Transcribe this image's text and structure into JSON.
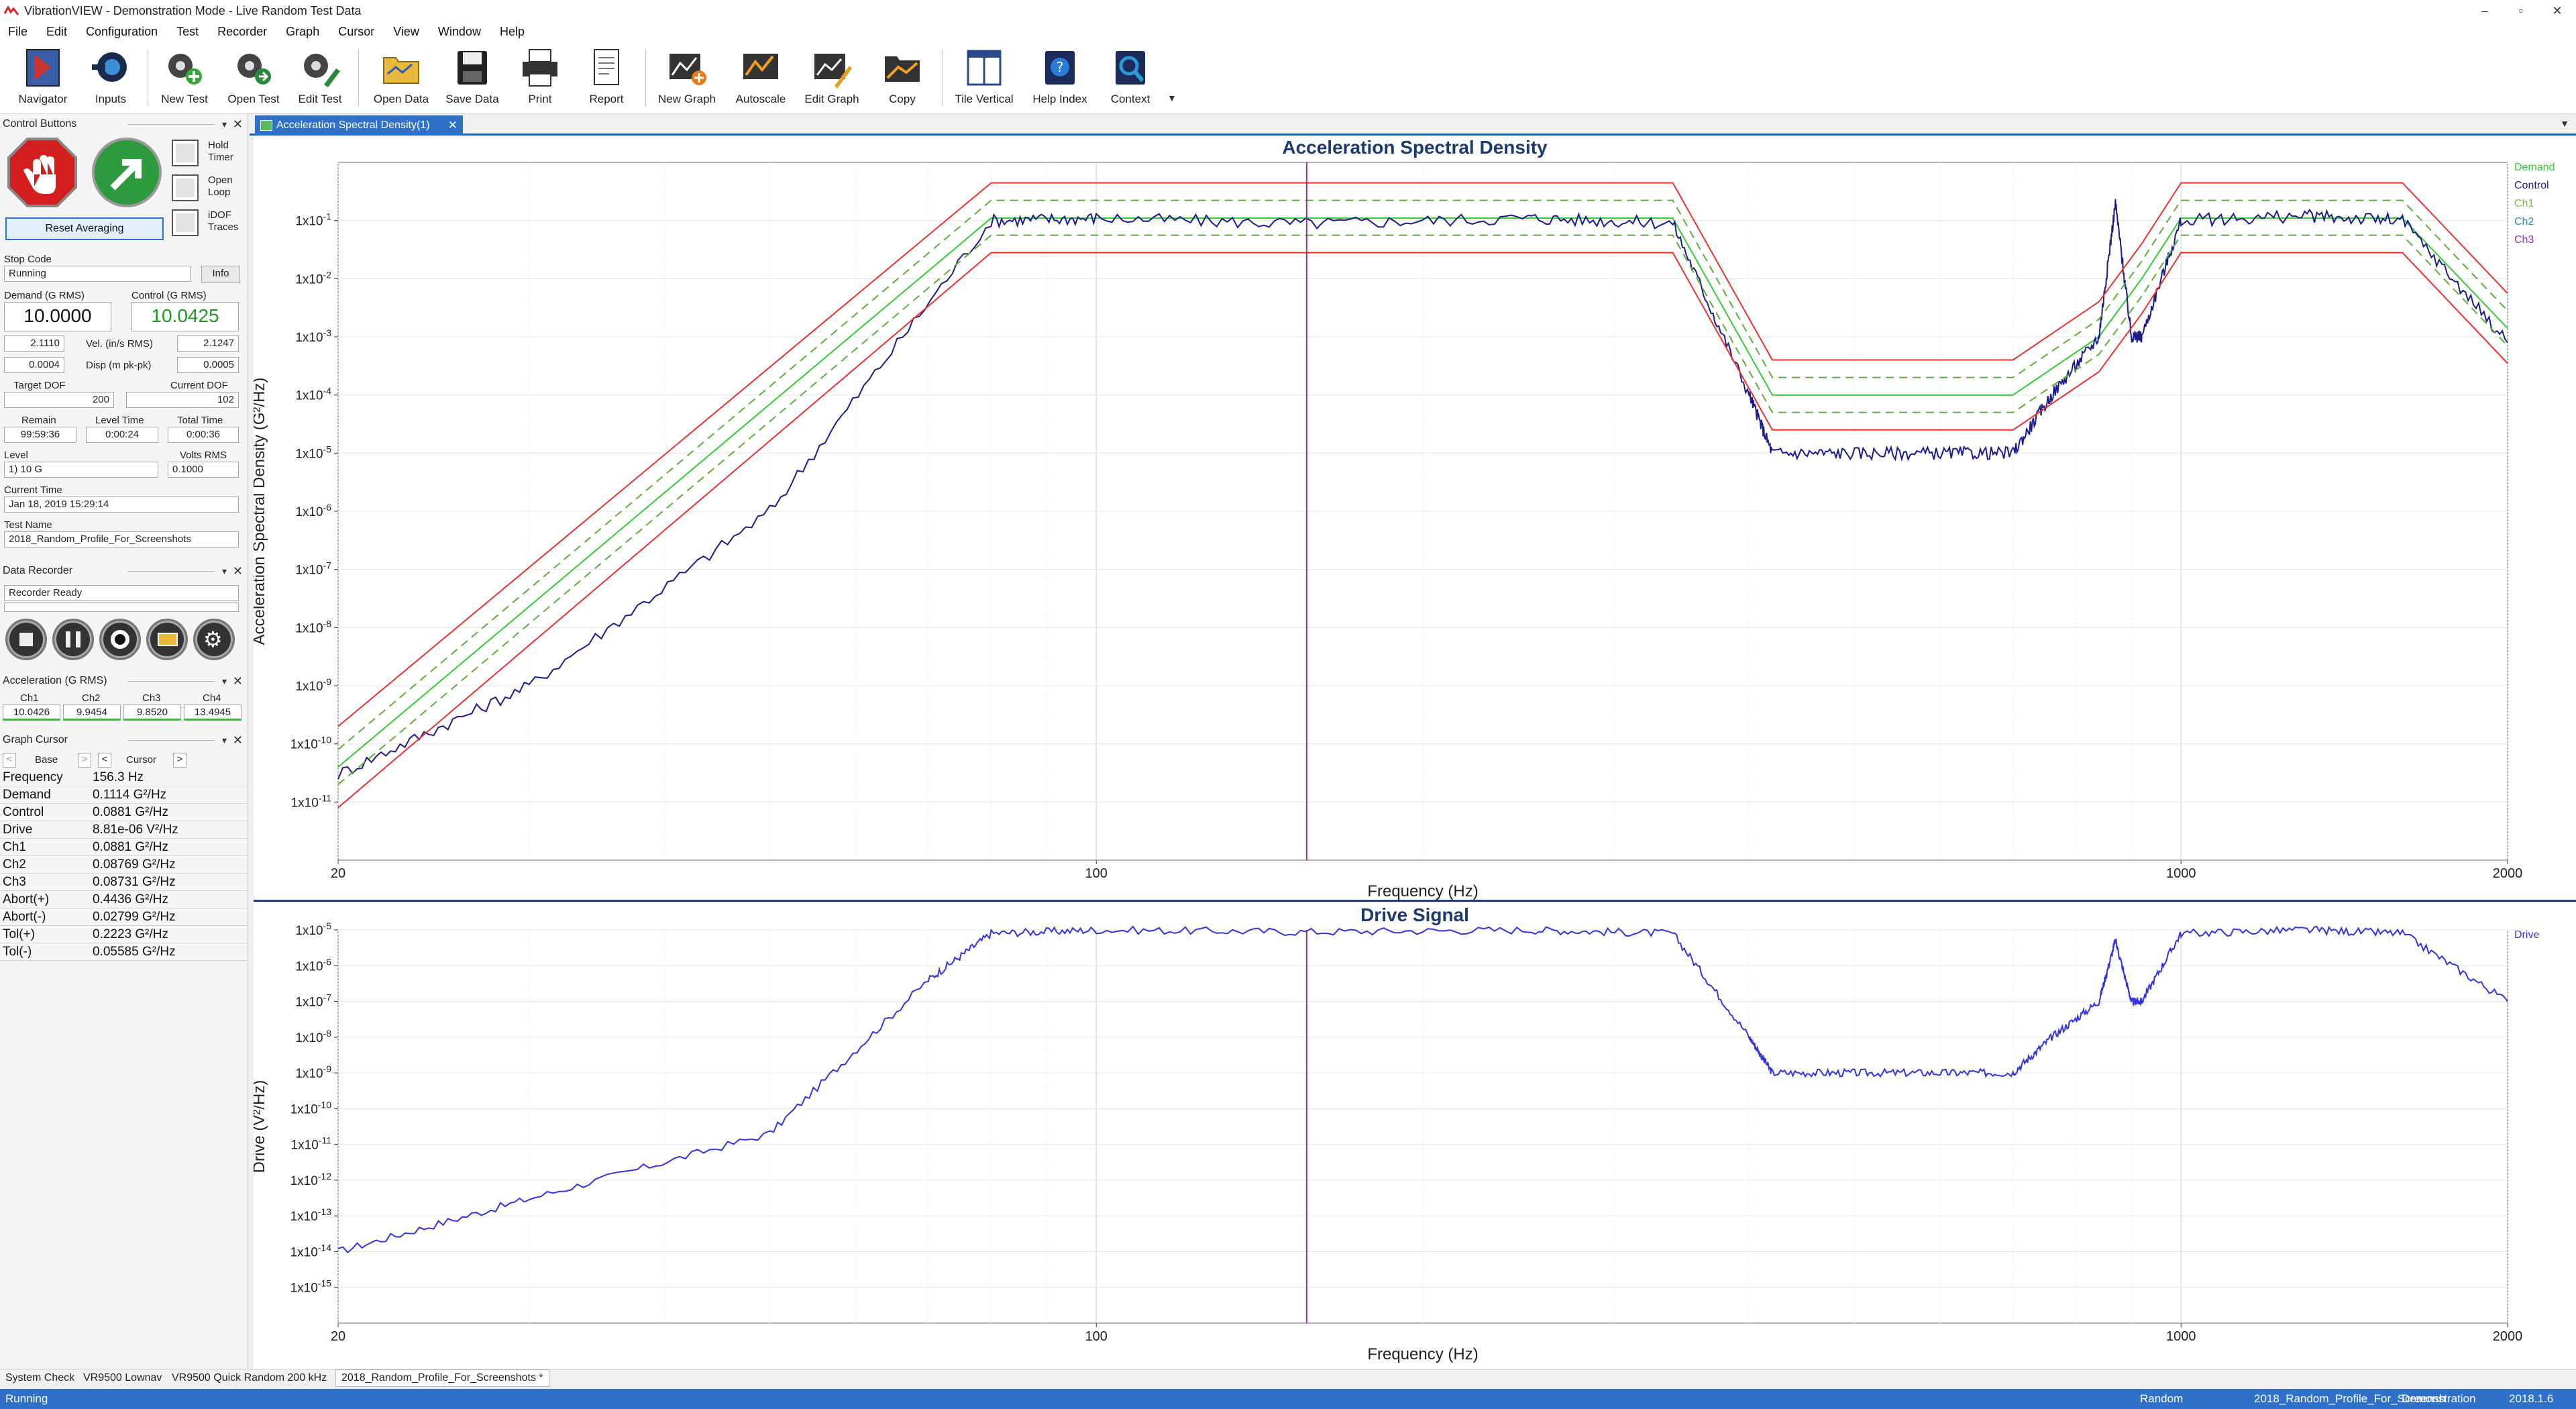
{
  "window": {
    "title": "VibrationVIEW - Demonstration Mode - Live Random Test Data",
    "controls": [
      "–",
      "▫",
      "✕"
    ]
  },
  "menu": [
    "File",
    "Edit",
    "Configuration",
    "Test",
    "Recorder",
    "Graph",
    "Cursor",
    "View",
    "Window",
    "Help"
  ],
  "toolbar": [
    {
      "label": "Navigator",
      "icon": "navigator-icon"
    },
    {
      "label": "Inputs",
      "icon": "inputs-icon"
    },
    {
      "label": "New Test",
      "icon": "new-test-icon"
    },
    {
      "label": "Open Test",
      "icon": "open-test-icon"
    },
    {
      "label": "Edit Test",
      "icon": "edit-test-icon"
    },
    {
      "label": "Open Data",
      "icon": "open-data-icon"
    },
    {
      "label": "Save Data",
      "icon": "save-data-icon"
    },
    {
      "label": "Print",
      "icon": "print-icon"
    },
    {
      "label": "Report",
      "icon": "report-icon"
    },
    {
      "label": "New Graph",
      "icon": "new-graph-icon"
    },
    {
      "label": "Autoscale",
      "icon": "autoscale-icon"
    },
    {
      "label": "Edit Graph",
      "icon": "edit-graph-icon"
    },
    {
      "label": "Copy",
      "icon": "copy-icon"
    },
    {
      "label": "Tile Vertical",
      "icon": "tile-vertical-icon"
    },
    {
      "label": "Help Index",
      "icon": "help-index-icon"
    },
    {
      "label": "Context",
      "icon": "context-icon"
    }
  ],
  "control_buttons": {
    "header": "Control Buttons",
    "hold_timer": "Hold Timer",
    "open_loop": "Open Loop",
    "idof_traces": "iDOF Traces",
    "reset_averaging": "Reset Averaging",
    "stop_code_label": "Stop Code",
    "stop_code_value": "Running",
    "info_button": "Info",
    "demand_label": "Demand (G RMS)",
    "demand_value": "10.0000",
    "control_label": "Control (G RMS)",
    "control_value": "10.0425",
    "vel_label": "Vel. (in/s RMS)",
    "vel_demand": "2.1110",
    "vel_control": "2.1247",
    "disp_label": "Disp (m pk-pk)",
    "disp_demand": "0.0004",
    "disp_control": "0.0005",
    "target_dof_label": "Target DOF",
    "target_dof_value": "200",
    "current_dof_label": "Current DOF",
    "current_dof_value": "102",
    "remain_label": "Remain",
    "remain_value": "99:59:36",
    "level_time_label": "Level Time",
    "level_time_value": "0:00:24",
    "total_time_label": "Total Time",
    "total_time_value": "0:00:36",
    "level_label": "Level",
    "level_value": "1) 10 G",
    "volts_rms_label": "Volts RMS",
    "volts_rms_value": "0.1000",
    "current_time_label": "Current Time",
    "current_time_value": "Jan 18, 2019 15:29:14",
    "test_name_label": "Test Name",
    "test_name_value": "2018_Random_Profile_For_Screenshots"
  },
  "data_recorder": {
    "header": "Data Recorder",
    "status": "Recorder Ready"
  },
  "acceleration": {
    "header": "Acceleration (G RMS)",
    "channels": [
      {
        "name": "Ch1",
        "value": "10.0426"
      },
      {
        "name": "Ch2",
        "value": "9.9454"
      },
      {
        "name": "Ch3",
        "value": "9.8520"
      },
      {
        "name": "Ch4",
        "value": "13.4945"
      }
    ]
  },
  "graph_cursor": {
    "header": "Graph Cursor",
    "base_label": "Base",
    "cursor_label": "Cursor",
    "rows": [
      {
        "name": "Frequency",
        "value": "156.3  Hz"
      },
      {
        "name": "Demand",
        "value": "0.1114  G²/Hz"
      },
      {
        "name": "Control",
        "value": "0.0881  G²/Hz"
      },
      {
        "name": "Drive",
        "value": "8.81e-06  V²/Hz"
      },
      {
        "name": "Ch1",
        "value": "0.0881  G²/Hz"
      },
      {
        "name": "Ch2",
        "value": "0.08769  G²/Hz"
      },
      {
        "name": "Ch3",
        "value": "0.08731  G²/Hz"
      },
      {
        "name": "Abort(+)",
        "value": "0.4436  G²/Hz"
      },
      {
        "name": "Abort(-)",
        "value": "0.02799  G²/Hz"
      },
      {
        "name": "Tol(+)",
        "value": "0.2223  G²/Hz"
      },
      {
        "name": "Tol(-)",
        "value": "0.05585  G²/Hz"
      }
    ]
  },
  "doc_tab": {
    "label": "Acceleration Spectral Density(1)"
  },
  "colors": {
    "accent": "#2f71c9",
    "abort": "#e8312f",
    "tolerance": "#5eac3a",
    "demand": "#36c936",
    "control": "#1b1b8a",
    "ch1": "#7fbf3f",
    "ch2": "#1e90c8",
    "ch3": "#9b2fb5",
    "drive": "#3333dd",
    "cursor": "#9b2f8a"
  },
  "chart_data": [
    {
      "type": "line",
      "title": "Acceleration Spectral Density",
      "xlabel": "Frequency (Hz)",
      "ylabel": "Acceleration Spectral Density (G²/Hz)",
      "x_scale": "log",
      "y_scale": "log",
      "xlim": [
        20,
        2000
      ],
      "ylim": [
        1e-12,
        1
      ],
      "x_ticks": [
        "20",
        "100",
        "1000",
        "2000"
      ],
      "y_ticks": [
        {
          "mant": "1x10",
          "exp": "-1"
        },
        {
          "mant": "1x10",
          "exp": "-2"
        },
        {
          "mant": "1x10",
          "exp": "-3"
        },
        {
          "mant": "1x10",
          "exp": "-4"
        },
        {
          "mant": "1x10",
          "exp": "-5"
        },
        {
          "mant": "1x10",
          "exp": "-6"
        },
        {
          "mant": "1x10",
          "exp": "-7"
        },
        {
          "mant": "1x10",
          "exp": "-8"
        },
        {
          "mant": "1x10",
          "exp": "-9"
        },
        {
          "mant": "1x10",
          "exp": "-10"
        },
        {
          "mant": "1x10",
          "exp": "-11"
        }
      ],
      "legend": [
        "Demand",
        "Control",
        "Ch1",
        "Ch2",
        "Ch3"
      ],
      "cursor_x": 156.3,
      "series": [
        {
          "name": "Demand",
          "x": [
            20,
            80,
            340,
            420,
            700,
            840,
            920,
            1000,
            1600,
            2000
          ],
          "y": [
            4e-11,
            0.11,
            0.11,
            0.0001,
            0.0001,
            0.001,
            0.01,
            0.11,
            0.11,
            0.0014
          ]
        },
        {
          "name": "Control",
          "x": [
            20,
            30,
            50,
            80,
            100,
            156,
            250,
            340,
            400,
            420,
            500,
            600,
            700,
            760,
            840,
            870,
            900,
            920,
            1000,
            1300,
            1600,
            2000
          ],
          "y": [
            3e-11,
            1e-09,
            1e-06,
            0.1,
            0.11,
            0.088,
            0.11,
            0.09,
            0.0001,
            1e-05,
            1e-05,
            1e-05,
            1e-05,
            0.0001,
            0.001,
            0.2,
            0.001,
            0.001,
            0.1,
            0.12,
            0.1,
            0.0008
          ]
        },
        {
          "name": "Abort(+)",
          "x": [
            20,
            80,
            340,
            420,
            700,
            840,
            920,
            1000,
            1600,
            2000
          ],
          "y": [
            2e-10,
            0.4436,
            0.4436,
            0.0004,
            0.0004,
            0.004,
            0.04,
            0.4436,
            0.4436,
            0.0056
          ]
        },
        {
          "name": "Abort(-)",
          "x": [
            20,
            80,
            340,
            420,
            700,
            840,
            920,
            1000,
            1600,
            2000
          ],
          "y": [
            8e-12,
            0.028,
            0.028,
            2.5e-05,
            2.5e-05,
            0.00025,
            0.0025,
            0.028,
            0.028,
            0.00035
          ]
        },
        {
          "name": "Tol(+)",
          "x": [
            20,
            80,
            340,
            420,
            700,
            840,
            920,
            1000,
            1600,
            2000
          ],
          "y": [
            8e-11,
            0.2223,
            0.2223,
            0.0002,
            0.0002,
            0.002,
            0.02,
            0.2223,
            0.2223,
            0.0028
          ]
        },
        {
          "name": "Tol(-)",
          "x": [
            20,
            80,
            340,
            420,
            700,
            840,
            920,
            1000,
            1600,
            2000
          ],
          "y": [
            2e-11,
            0.05585,
            0.05585,
            5e-05,
            5e-05,
            0.0005,
            0.005,
            0.05585,
            0.05585,
            0.0007
          ]
        }
      ]
    },
    {
      "type": "line",
      "title": "Drive Signal",
      "xlabel": "Frequency (Hz)",
      "ylabel": "Drive (V²/Hz)",
      "x_scale": "log",
      "y_scale": "log",
      "xlim": [
        20,
        2000
      ],
      "ylim": [
        1e-16,
        1e-05
      ],
      "x_ticks": [
        "20",
        "100",
        "1000",
        "2000"
      ],
      "y_ticks": [
        {
          "mant": "1x10",
          "exp": "-5"
        },
        {
          "mant": "1x10",
          "exp": "-6"
        },
        {
          "mant": "1x10",
          "exp": "-7"
        },
        {
          "mant": "1x10",
          "exp": "-8"
        },
        {
          "mant": "1x10",
          "exp": "-9"
        },
        {
          "mant": "1x10",
          "exp": "-10"
        },
        {
          "mant": "1x10",
          "exp": "-11"
        },
        {
          "mant": "1x10",
          "exp": "-12"
        },
        {
          "mant": "1x10",
          "exp": "-13"
        },
        {
          "mant": "1x10",
          "exp": "-14"
        },
        {
          "mant": "1x10",
          "exp": "-15"
        }
      ],
      "legend": [
        "Drive"
      ],
      "cursor_x": 156.3,
      "series": [
        {
          "name": "Drive",
          "x": [
            20,
            30,
            50,
            70,
            80,
            100,
            156,
            250,
            340,
            400,
            420,
            500,
            600,
            700,
            760,
            840,
            870,
            900,
            920,
            1000,
            1300,
            1600,
            2000
          ],
          "y": [
            1e-14,
            3e-13,
            2e-11,
            4e-07,
            8e-06,
            1e-05,
            8.81e-06,
            1e-05,
            8e-06,
            1e-08,
            1e-09,
            1e-09,
            1e-09,
            1e-09,
            1e-08,
            1e-07,
            5e-06,
            1e-07,
            1e-07,
            8e-06,
            1e-05,
            8e-06,
            1e-07
          ]
        }
      ]
    }
  ],
  "bottom_tabs": [
    "System Check",
    "VR9500 Lownav",
    "VR9500 Quick Random 200 kHz",
    "2018_Random_Profile_For_Screenshots *"
  ],
  "status": {
    "left": "Running",
    "mode": "Random",
    "test": "2018_Random_Profile_For_Screensh",
    "demo": "Demonstration",
    "version": "2018.1.6"
  }
}
